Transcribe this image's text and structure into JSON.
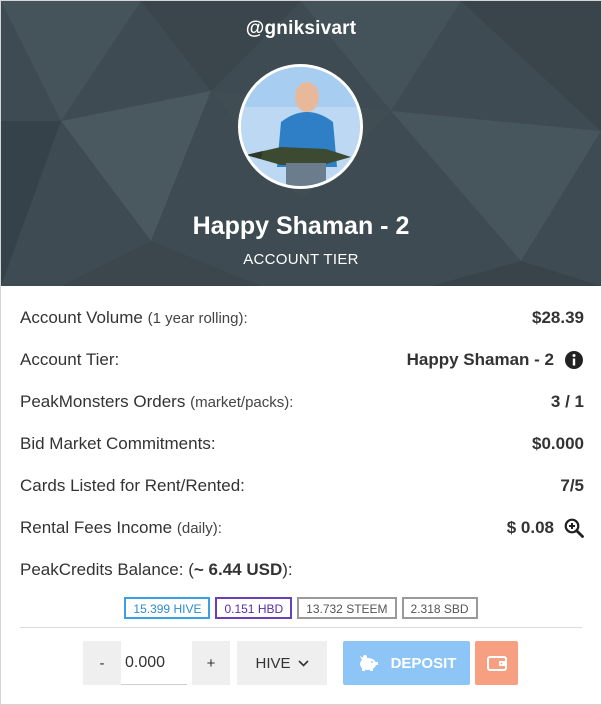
{
  "header": {
    "username": "@gniksivart",
    "tier_name": "Happy Shaman - 2",
    "tier_caption": "ACCOUNT TIER"
  },
  "rows": [
    {
      "label": "Account Volume",
      "sub": "(1 year rolling):",
      "value": "$28.39"
    },
    {
      "label": "Account Tier:",
      "sub": "",
      "value": "Happy Shaman - 2"
    },
    {
      "label": "PeakMonsters Orders",
      "sub": "(market/packs):",
      "value": "3 / 1"
    },
    {
      "label": "Bid Market Commitments:",
      "sub": "",
      "value": "$0.000"
    },
    {
      "label": "Cards Listed for Rent/Rented:",
      "sub": "",
      "value": "7/5"
    },
    {
      "label": "Rental Fees Income",
      "sub": "(daily):",
      "value": "$ 0.08"
    },
    {
      "label": "PeakCredits Balance: (",
      "bold": "~ 6.44 USD",
      "suffix": "):"
    }
  ],
  "balances": {
    "hive": "15.399 HIVE",
    "hbd": "0.151 HBD",
    "steem": "13.732 STEEM",
    "sbd": "2.318 SBD"
  },
  "controls": {
    "minus": "-",
    "plus": "+",
    "amount": "0.000",
    "currency": "HIVE",
    "deposit": "DEPOSIT"
  },
  "icons": {
    "tier_info": "info-icon",
    "rental_details": "zoom-in-icon",
    "deposit": "piggy-bank-icon",
    "wallet": "wallet-icon",
    "currency_dropdown": "chevron-down-icon"
  },
  "colors": {
    "header_bg": "#3e4b52",
    "hive_border": "#3d9ee6",
    "hbd_border": "#6a3fb5",
    "deposit_bg": "#8dc6f6",
    "wallet_bg": "#f6a081"
  }
}
